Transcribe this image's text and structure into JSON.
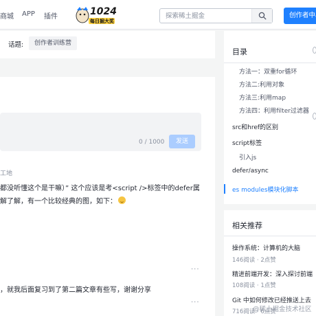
{
  "header": {
    "nav": [
      "商城",
      "APP",
      "插件"
    ],
    "logo_text": "1024",
    "logo_subtext": "每日掘大奖",
    "search_placeholder": "探索稀土掘金",
    "creator_button": "创作者中心"
  },
  "topic": {
    "label": "话题:",
    "tag": "创作者训练营"
  },
  "comment": {
    "count": "0 / 1000",
    "send_label": "发送",
    "entries": [
      {
        "author_tail": "工地",
        "lines": [
          "都没听懂这个是干嘛）” 这个应该是考<script />标签中的defer属",
          "解了解，有一个比较经典的图，如下："
        ]
      },
      {
        "lines": [
          "，就我后面复习到了第二篇文章有些写，谢谢分享"
        ]
      }
    ],
    "more_icon": "..."
  },
  "toc": {
    "title": "目录",
    "items": [
      {
        "label": "方法一：双重for循环",
        "level": 2
      },
      {
        "label": "方法二:利用对象",
        "level": 2
      },
      {
        "label": "方法三:利用map",
        "level": 2
      },
      {
        "label": "方法四：利用filter过滤器",
        "level": 2
      },
      {
        "label": "src和href的区别",
        "level": 1
      },
      {
        "label": "script标签",
        "level": 1
      },
      {
        "label": "引入js",
        "level": 2
      },
      {
        "label": "defer/async",
        "level": 1
      },
      {
        "label": "es modules模块化脚本",
        "level": 1,
        "active": true
      }
    ]
  },
  "recommend": {
    "title": "相关推荐",
    "items": [
      {
        "title": "操作系统：计算机的大脑",
        "meta": "146阅读 · 2点赞"
      },
      {
        "title": "精进前端开发：深入探讨前端",
        "meta": "108阅读 · 1点赞"
      },
      {
        "title": "Git 中如何修改已经推送上去",
        "meta": "716阅读 · 6点赞"
      }
    ]
  },
  "watermark": "@稀土掘金技术社区",
  "colors": {
    "accent": "#1e80ff",
    "send_disabled": "#abcdff",
    "page_bg": "#f4f5f5"
  }
}
